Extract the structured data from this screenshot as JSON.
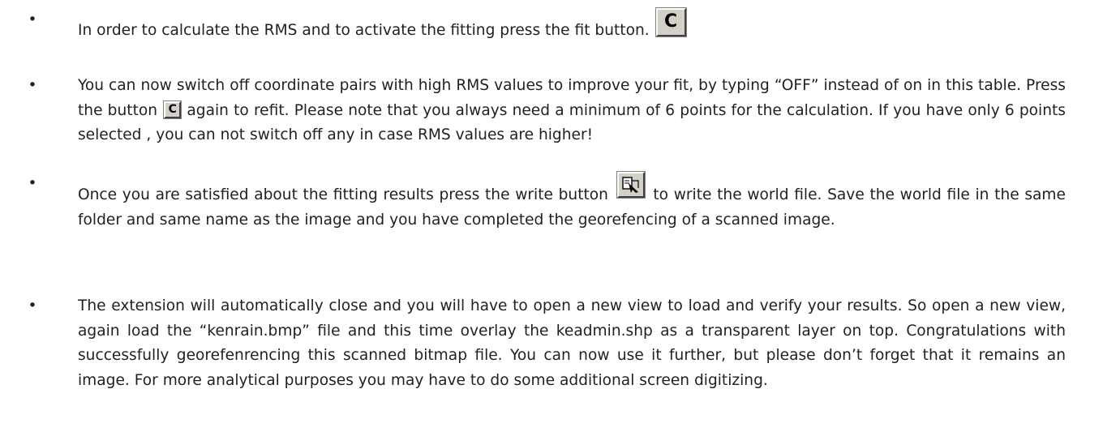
{
  "bullet_marker": "•",
  "items": [
    {
      "text": "In order to calculate the RMS and to activate the fitting press the fit button.",
      "icon_glyph": "C"
    },
    {
      "text_1": "You can now switch off coordinate pairs with high RMS values to improve your fit, by typing “OFF” instead of on in this table. Press the button",
      "icon_glyph": "C",
      "text_2": "again to refit. Please note that you always need a minimum of 6 points for the calculation. If you have only 6 points selected , you can not switch off any in case RMS values are higher!"
    },
    {
      "text_1": "Once you are satisfied about the fitting results press the write button",
      "icon": "write-file-icon",
      "text_2": "to write the world file. Save the world file in the same folder and same name as the image and you have completed the georefencing of a scanned image."
    },
    {
      "text": "The extension will automatically close and you will have to open a new view to load and verify your results. So open a new view, again load the “kenrain.bmp” file and this time overlay the keadmin.shp as a transparent layer on top.  Congratulations with successfully georefenrencing this scanned bitmap file. You can now use it further, but please don’t forget that it remains an image. For more analytical purposes you may have to do some additional screen digitizing."
    }
  ]
}
